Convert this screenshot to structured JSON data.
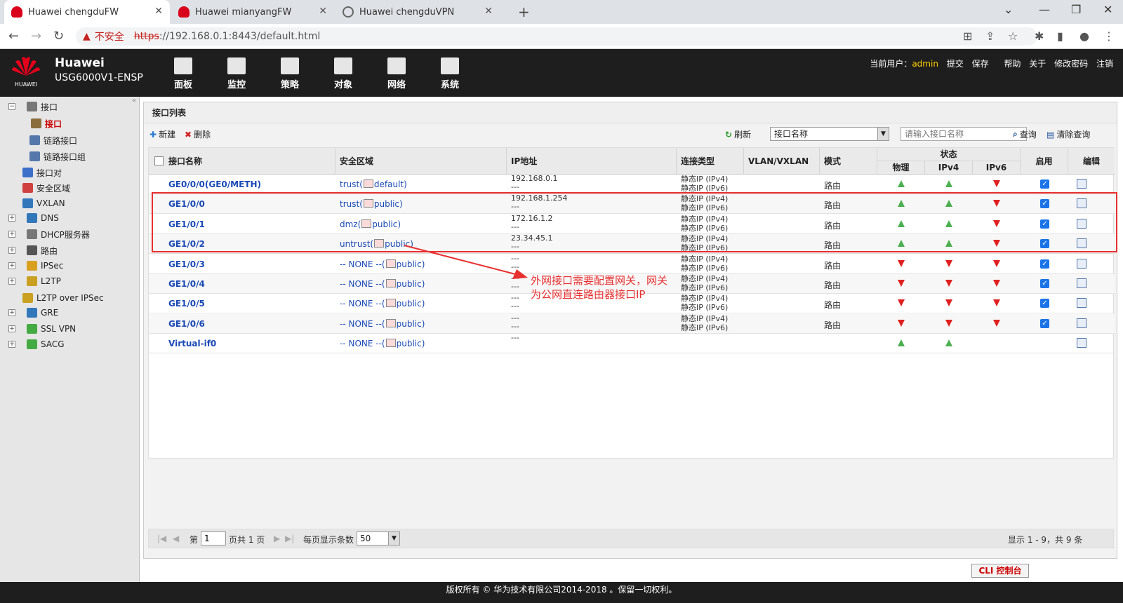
{
  "browser": {
    "tabs": [
      {
        "title": "Huawei chengduFW",
        "active": true
      },
      {
        "title": "Huawei mianyangFW",
        "active": false
      },
      {
        "title": "Huawei chengduVPN",
        "active": false
      }
    ],
    "security_label": "不安全",
    "url_scheme": "https",
    "url_rest": "://192.168.0.1:8443/default.html"
  },
  "app": {
    "brand": "Huawei",
    "brand_sub": "HUAWEI",
    "product": "USG6000V1-ENSP",
    "menu": [
      {
        "label": "面板"
      },
      {
        "label": "监控"
      },
      {
        "label": "策略"
      },
      {
        "label": "对象"
      },
      {
        "label": "网络"
      },
      {
        "label": "系统"
      }
    ],
    "user_label": "当前用户：",
    "username": "admin",
    "actions": [
      "提交",
      "保存",
      "帮助",
      "关于",
      "修改密码",
      "注销"
    ]
  },
  "sidebar": {
    "items": [
      {
        "label": "接口",
        "expand": "−",
        "color": "#777"
      },
      {
        "label": "接口",
        "selected": true,
        "color": "#8a6d3b"
      },
      {
        "label": "链路接口",
        "color": "#5577aa"
      },
      {
        "label": "链路接口组",
        "color": "#5577aa"
      },
      {
        "label": "接口对",
        "color": "#3b6fc9"
      },
      {
        "label": "安全区域",
        "color": "#d04040"
      },
      {
        "label": "VXLAN",
        "color": "#3377bb"
      },
      {
        "label": "DNS",
        "expand": "+",
        "color": "#3377bb"
      },
      {
        "label": "DHCP服务器",
        "expand": "+",
        "color": "#777"
      },
      {
        "label": "路由",
        "expand": "+",
        "color": "#555"
      },
      {
        "label": "IPSec",
        "expand": "+",
        "color": "#d9a020"
      },
      {
        "label": "L2TP",
        "expand": "+",
        "color": "#c9a020"
      },
      {
        "label": "L2TP over IPSec",
        "color": "#c9a020"
      },
      {
        "label": "GRE",
        "expand": "+",
        "color": "#3377bb"
      },
      {
        "label": "SSL VPN",
        "expand": "+",
        "color": "#44aa44"
      },
      {
        "label": "SACG",
        "expand": "+",
        "color": "#44aa44"
      }
    ]
  },
  "panel": {
    "title": "接口列表",
    "new_label": "新建",
    "delete_label": "删除",
    "refresh_label": "刷新",
    "sort_field": "接口名称",
    "search_placeholder": "请输入接口名称",
    "query_label": "查询",
    "clear_label": "清除查询"
  },
  "table": {
    "headers": {
      "name": "接口名称",
      "zone": "安全区域",
      "ip": "IP地址",
      "type": "连接类型",
      "vlan": "VLAN/VXLAN",
      "mode": "模式",
      "status": "状态",
      "phy": "物理",
      "ipv4": "IPv4",
      "ipv6": "IPv6",
      "enable": "启用",
      "edit": "编辑"
    },
    "rows": [
      {
        "name": "GE0/0/0(GE0/METH)",
        "zone": "trust(",
        "vsys": "default)",
        "ip1": "192.168.0.1",
        "ip2": "---",
        "t1": "静态IP (IPv4)",
        "t2": "静态IP (IPv6)",
        "mode": "路由",
        "phy": "up",
        "v4": "up",
        "v6": "down",
        "enabled": true
      },
      {
        "name": "GE1/0/0",
        "zone": "trust(",
        "vsys": "public)",
        "ip1": "192.168.1.254",
        "ip2": "---",
        "t1": "静态IP (IPv4)",
        "t2": "静态IP (IPv6)",
        "mode": "路由",
        "phy": "up",
        "v4": "up",
        "v6": "down",
        "enabled": true
      },
      {
        "name": "GE1/0/1",
        "zone": "dmz(",
        "vsys": "public)",
        "ip1": "172.16.1.2",
        "ip2": "---",
        "t1": "静态IP (IPv4)",
        "t2": "静态IP (IPv6)",
        "mode": "路由",
        "phy": "up",
        "v4": "up",
        "v6": "down",
        "enabled": true
      },
      {
        "name": "GE1/0/2",
        "zone": "untrust(",
        "vsys": "public)",
        "ip1": "23.34.45.1",
        "ip2": "---",
        "t1": "静态IP (IPv4)",
        "t2": "静态IP (IPv6)",
        "mode": "路由",
        "phy": "up",
        "v4": "up",
        "v6": "down",
        "enabled": true
      },
      {
        "name": "GE1/0/3",
        "zone": "-- NONE --(",
        "vsys": "public)",
        "ip1": "---",
        "ip2": "---",
        "t1": "静态IP (IPv4)",
        "t2": "静态IP (IPv6)",
        "mode": "路由",
        "phy": "down",
        "v4": "down",
        "v6": "down",
        "enabled": true
      },
      {
        "name": "GE1/0/4",
        "zone": "-- NONE --(",
        "vsys": "public)",
        "ip1": "---",
        "ip2": "---",
        "t1": "静态IP (IPv4)",
        "t2": "静态IP (IPv6)",
        "mode": "路由",
        "phy": "down",
        "v4": "down",
        "v6": "down",
        "enabled": true
      },
      {
        "name": "GE1/0/5",
        "zone": "-- NONE --(",
        "vsys": "public)",
        "ip1": "---",
        "ip2": "---",
        "t1": "静态IP (IPv4)",
        "t2": "静态IP (IPv6)",
        "mode": "路由",
        "phy": "down",
        "v4": "down",
        "v6": "down",
        "enabled": true
      },
      {
        "name": "GE1/0/6",
        "zone": "-- NONE --(",
        "vsys": "public)",
        "ip1": "---",
        "ip2": "---",
        "t1": "静态IP (IPv4)",
        "t2": "静态IP (IPv6)",
        "mode": "路由",
        "phy": "down",
        "v4": "down",
        "v6": "down",
        "enabled": true
      },
      {
        "name": "Virtual-if0",
        "zone": "-- NONE --(",
        "vsys": "public)",
        "ip1": "---",
        "ip2": "",
        "t1": "",
        "t2": "",
        "mode": "",
        "phy": "up",
        "v4": "up",
        "v6": "",
        "enabled": false
      }
    ]
  },
  "pager": {
    "page_prefix": "第",
    "page": "1",
    "page_suffix": "页共 1 页",
    "size_label": "每页显示条数",
    "size": "50",
    "summary": "显示 1 - 9，共 9 条"
  },
  "cli_button": "CLI 控制台",
  "footer": "版权所有 © 华为技术有限公司2014-2018 。保留一切权利。",
  "annotation": {
    "line1": "外网接口需要配置网关，网关",
    "line2": "为公网直连路由器接口IP",
    "color": "#e83030"
  },
  "colors": {
    "status_up": "#4caf50",
    "status_down": "#e02020",
    "link": "#1a49b5",
    "header_bg": "#1e1e1e"
  }
}
